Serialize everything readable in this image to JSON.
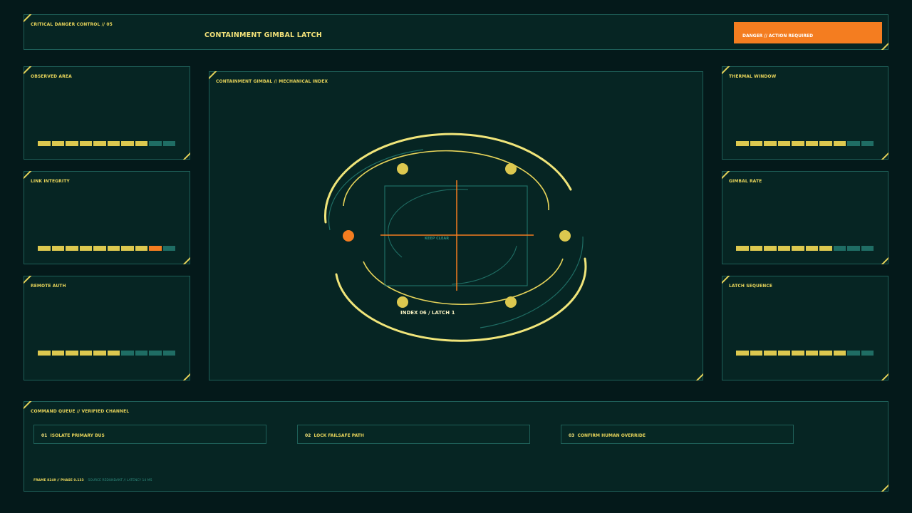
{
  "header": {
    "label": "CRITICAL DANGER CONTROL // 05",
    "title": "CONTAINMENT GIMBAL LATCH",
    "badge": "DANGER // ACTION REQUIRED"
  },
  "left_panels": [
    {
      "label": "OBSERVED AREA",
      "segments": [
        "on",
        "on",
        "on",
        "on",
        "on",
        "on",
        "on",
        "on",
        "off",
        "off"
      ]
    },
    {
      "label": "LINK INTEGRITY",
      "segments": [
        "on",
        "on",
        "on",
        "on",
        "on",
        "on",
        "on",
        "on",
        "alert",
        "off"
      ]
    },
    {
      "label": "REMOTE AUTH",
      "segments": [
        "on",
        "on",
        "on",
        "on",
        "on",
        "on",
        "off",
        "off",
        "off",
        "off"
      ]
    }
  ],
  "right_panels": [
    {
      "label": "THERMAL WINDOW",
      "segments": [
        "on",
        "on",
        "on",
        "on",
        "on",
        "on",
        "on",
        "on",
        "off",
        "off"
      ]
    },
    {
      "label": "GIMBAL RATE",
      "segments": [
        "on",
        "on",
        "on",
        "on",
        "on",
        "on",
        "on",
        "off",
        "off",
        "off"
      ]
    },
    {
      "label": "LATCH SEQUENCE",
      "segments": [
        "on",
        "on",
        "on",
        "on",
        "on",
        "on",
        "on",
        "on",
        "off",
        "off"
      ]
    }
  ],
  "center": {
    "label": "CONTAINMENT GIMBAL // MECHANICAL INDEX",
    "keep_clear": "KEEP CLEAR",
    "index_label": "INDEX 06 / LATCH 1"
  },
  "queue": {
    "label": "COMMAND QUEUE // VERIFIED CHANNEL",
    "commands": [
      {
        "num": "01",
        "text": "ISOLATE PRIMARY BUS"
      },
      {
        "num": "02",
        "text": "LOCK FAILSAFE PATH"
      },
      {
        "num": "03",
        "text": "CONFIRM HUMAN OVERRIDE"
      }
    ],
    "footer": {
      "frame": "FRAME 8249",
      "phase": "PHASE 0.133",
      "source": "SOURCE REDUNDANT",
      "latency": "LATENCY 14 MS"
    }
  },
  "colors": {
    "background": "#04191a",
    "panel": "#062523",
    "accent_yellow": "#e6d35a",
    "alert_orange": "#f47d20",
    "dim_teal": "#1f6d64"
  }
}
